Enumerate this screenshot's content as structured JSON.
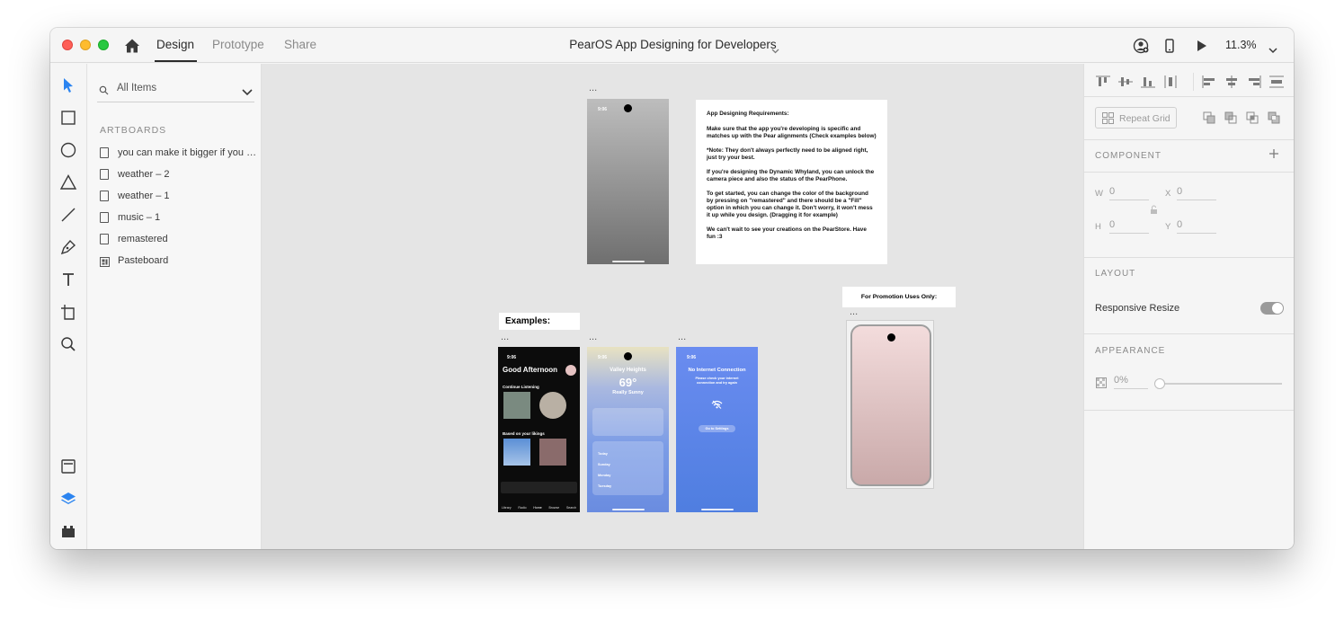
{
  "titlebar": {
    "tabs": [
      {
        "label": "Design",
        "active": true
      },
      {
        "label": "Prototype",
        "active": false
      },
      {
        "label": "Share",
        "active": false
      }
    ],
    "document_title": "PearOS App Designing for Developers",
    "zoom": "11.3%"
  },
  "layers": {
    "search_placeholder": "All Items",
    "section_label": "ARTBOARDS",
    "items": [
      {
        "label": "you can make it bigger if you want",
        "icon": "artboard-icon"
      },
      {
        "label": "weather – 2",
        "icon": "artboard-icon"
      },
      {
        "label": "weather – 1",
        "icon": "artboard-icon"
      },
      {
        "label": "music – 1",
        "icon": "artboard-icon"
      },
      {
        "label": "remastered",
        "icon": "artboard-icon"
      },
      {
        "label": "Pasteboard",
        "icon": "pasteboard-icon"
      }
    ]
  },
  "canvas": {
    "artboard_dots": "...",
    "status_time": "9:06",
    "requirements": {
      "heading": "App Designing Requirements:",
      "paragraphs": [
        "Make sure that the app you're developing is specific and matches up with the Pear alignments (Check examples below)",
        "*Note: They don't always perfectly need to be aligned right, just try your best.",
        "If you're designing the Dynamic Whyland, you can unlock the camera piece and also the status of the PearPhone.",
        "To get started, you can change the color of the background by pressing on \"remastered\" and there should be a \"Fill\" option in which you can change it. Don't worry, it won't mess it up while you design. (Dragging it for example)",
        "We can't wait to see your creations on the PearStore. Have fun :3"
      ]
    },
    "examples_label": "Examples:",
    "promo_label": "For Promotion Uses Only:",
    "music": {
      "greeting": "Good Afternoon",
      "continue_listening": "Continue Listening",
      "based_on": "Based on your likings",
      "tabs": [
        "Library",
        "Radio",
        "Home",
        "Browse",
        "Search"
      ]
    },
    "weather": {
      "location": "Valley Heights",
      "temp": "69°",
      "condition": "Really Sunny",
      "days": [
        "Today",
        "Sunday",
        "Monday",
        "Tuesday"
      ]
    },
    "nointernet": {
      "title": "No Internet Connection",
      "message": "Please check your internet connection and try again",
      "button": "Go to Settings"
    }
  },
  "properties": {
    "component_label": "COMPONENT",
    "repeat_grid": "Repeat Grid",
    "w_label": "W",
    "w_value": "0",
    "h_label": "H",
    "h_value": "0",
    "x_label": "X",
    "x_value": "0",
    "y_label": "Y",
    "y_value": "0",
    "layout_label": "LAYOUT",
    "responsive_resize": "Responsive Resize",
    "responsive_on": true,
    "appearance_label": "APPEARANCE",
    "opacity": "0%"
  }
}
